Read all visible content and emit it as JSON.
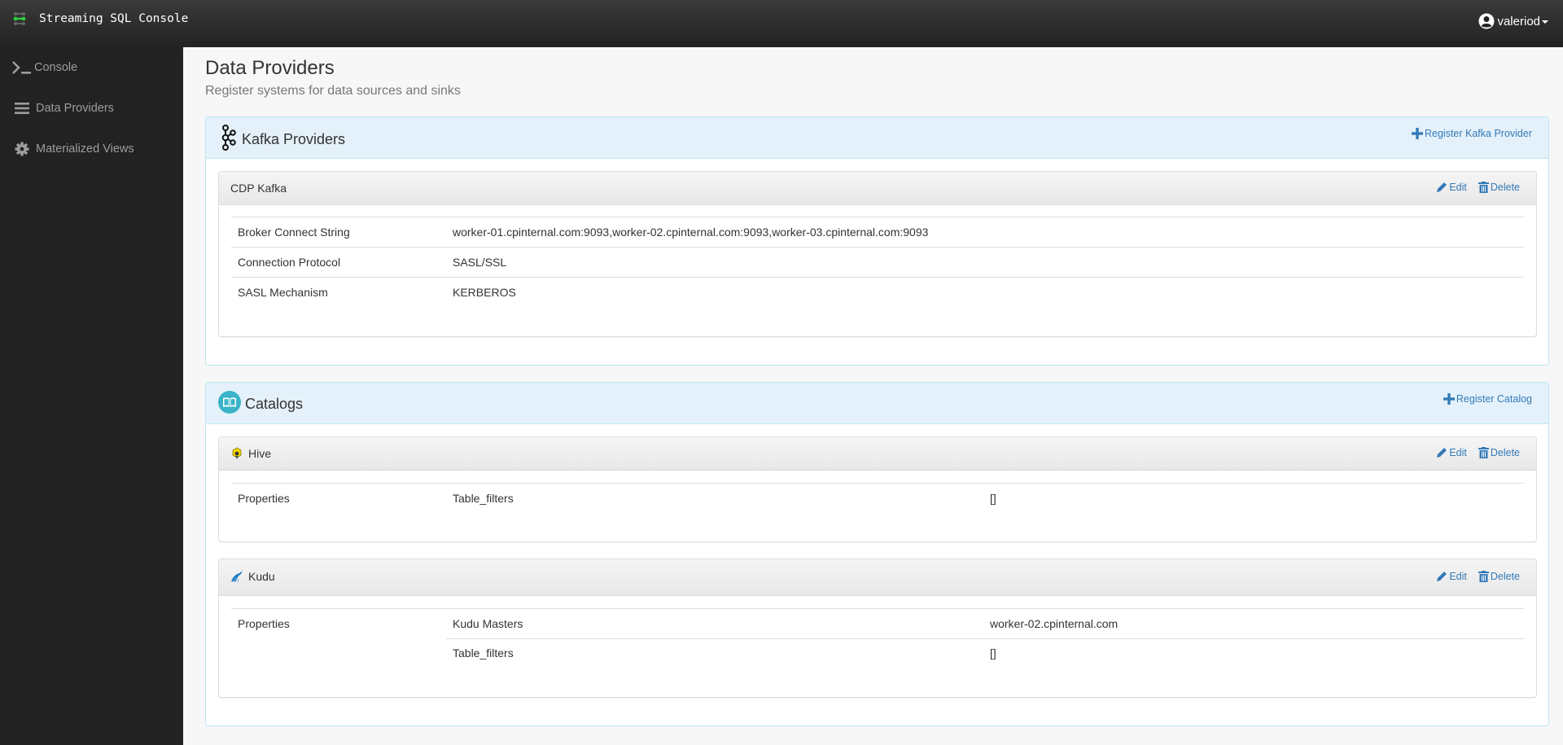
{
  "app": {
    "title": "Streaming SQL Console",
    "logo_icon": "streaming-logo-icon",
    "user": {
      "name": "valeriod",
      "icon": "user-circle-icon"
    }
  },
  "sidebar": {
    "items": [
      {
        "label": "Console",
        "icon": "terminal-icon"
      },
      {
        "label": "Data Providers",
        "icon": "bars-icon"
      },
      {
        "label": "Materialized Views",
        "icon": "gear-icon"
      }
    ]
  },
  "page": {
    "title": "Data Providers",
    "subtitle": "Register systems for data sources and sinks"
  },
  "kafka": {
    "title": "Kafka Providers",
    "icon": "kafka-icon",
    "register_label": "Register Kafka Provider",
    "providers": [
      {
        "name": "CDP Kafka",
        "edit_label": "Edit",
        "delete_label": "Delete",
        "rows": [
          {
            "key": "Broker Connect String",
            "value": "worker-01.cpinternal.com:9093,worker-02.cpinternal.com:9093,worker-03.cpinternal.com:9093"
          },
          {
            "key": "Connection Protocol",
            "value": "SASL/SSL"
          },
          {
            "key": "SASL Mechanism",
            "value": "KERBEROS"
          }
        ]
      }
    ]
  },
  "catalogs": {
    "title": "Catalogs",
    "icon": "book-icon",
    "register_label": "Register Catalog",
    "items": [
      {
        "name": "Hive",
        "icon": "hive-icon",
        "edit_label": "Edit",
        "delete_label": "Delete",
        "properties_label": "Properties",
        "properties": [
          {
            "key": "Table_filters",
            "value": "[]"
          }
        ]
      },
      {
        "name": "Kudu",
        "icon": "kudu-icon",
        "edit_label": "Edit",
        "delete_label": "Delete",
        "properties_label": "Properties",
        "properties": [
          {
            "key": "Kudu Masters",
            "value": "worker-02.cpinternal.com"
          },
          {
            "key": "Table_filters",
            "value": "[]"
          }
        ]
      }
    ]
  },
  "colors": {
    "navbar": "#222222",
    "link": "#337ab7",
    "panel_heading": "#e4f1fa",
    "panel_border": "#bce8f1",
    "logo_green": "#2ecc40"
  }
}
